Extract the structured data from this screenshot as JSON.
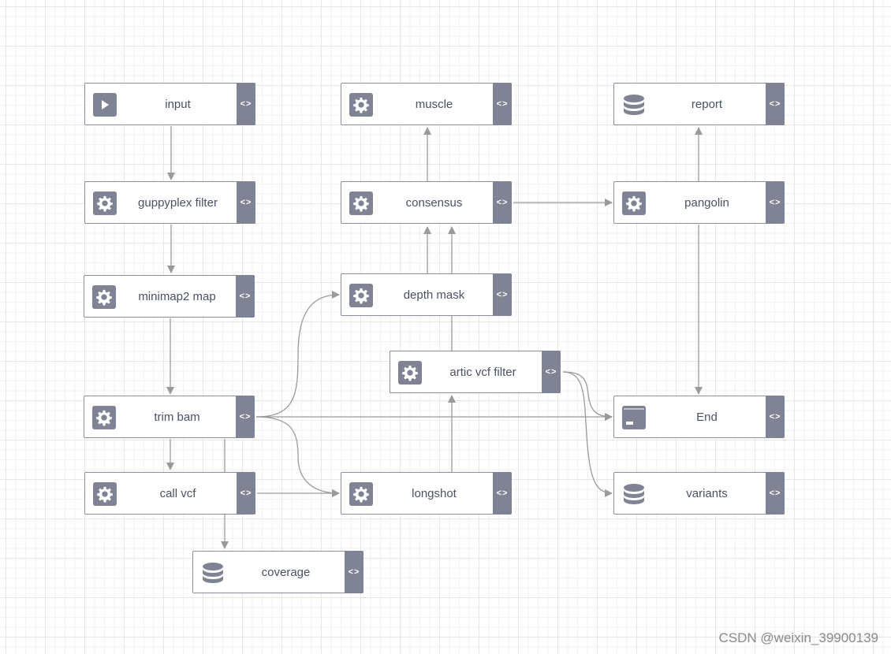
{
  "diagram": {
    "nodes": [
      {
        "id": "input",
        "label": "input",
        "icon": "play-icon"
      },
      {
        "id": "guppyplex_filter",
        "label": "guppyplex filter",
        "icon": "gear-icon"
      },
      {
        "id": "minimap2_map",
        "label": "minimap2 map",
        "icon": "gear-icon"
      },
      {
        "id": "trim_bam",
        "label": "trim bam",
        "icon": "gear-icon"
      },
      {
        "id": "call_vcf",
        "label": "call vcf",
        "icon": "gear-icon"
      },
      {
        "id": "coverage",
        "label": "coverage",
        "icon": "database-icon"
      },
      {
        "id": "muscle",
        "label": "muscle",
        "icon": "gear-icon"
      },
      {
        "id": "consensus",
        "label": "consensus",
        "icon": "gear-icon"
      },
      {
        "id": "depth_mask",
        "label": "depth mask",
        "icon": "gear-icon"
      },
      {
        "id": "artic_vcf_filter",
        "label": "artic vcf filter",
        "icon": "gear-icon"
      },
      {
        "id": "longshot",
        "label": "longshot",
        "icon": "gear-icon"
      },
      {
        "id": "report",
        "label": "report",
        "icon": "database-icon"
      },
      {
        "id": "pangolin",
        "label": "pangolin",
        "icon": "gear-icon"
      },
      {
        "id": "end",
        "label": "End",
        "icon": "end-icon"
      },
      {
        "id": "variants",
        "label": "variants",
        "icon": "database-icon"
      }
    ],
    "edges": [
      {
        "from": "input",
        "to": "guppyplex_filter"
      },
      {
        "from": "guppyplex_filter",
        "to": "minimap2_map"
      },
      {
        "from": "minimap2_map",
        "to": "trim_bam"
      },
      {
        "from": "trim_bam",
        "to": "call_vcf"
      },
      {
        "from": "trim_bam",
        "to": "coverage"
      },
      {
        "from": "trim_bam",
        "to": "depth_mask"
      },
      {
        "from": "trim_bam",
        "to": "end"
      },
      {
        "from": "trim_bam",
        "to": "longshot"
      },
      {
        "from": "call_vcf",
        "to": "longshot"
      },
      {
        "from": "longshot",
        "to": "artic_vcf_filter"
      },
      {
        "from": "artic_vcf_filter",
        "to": "consensus"
      },
      {
        "from": "artic_vcf_filter",
        "to": "end"
      },
      {
        "from": "artic_vcf_filter",
        "to": "variants"
      },
      {
        "from": "depth_mask",
        "to": "consensus"
      },
      {
        "from": "consensus",
        "to": "muscle"
      },
      {
        "from": "consensus",
        "to": "pangolin"
      },
      {
        "from": "pangolin",
        "to": "report"
      },
      {
        "from": "pangolin",
        "to": "end"
      }
    ],
    "code_toggle_glyph": "<>"
  },
  "watermark": "CSDN @weixin_39900139",
  "colors": {
    "node_border": "#8a8d9a",
    "accent": "#7f8393",
    "edge": "#9a9a9a",
    "label": "#4a5163"
  }
}
